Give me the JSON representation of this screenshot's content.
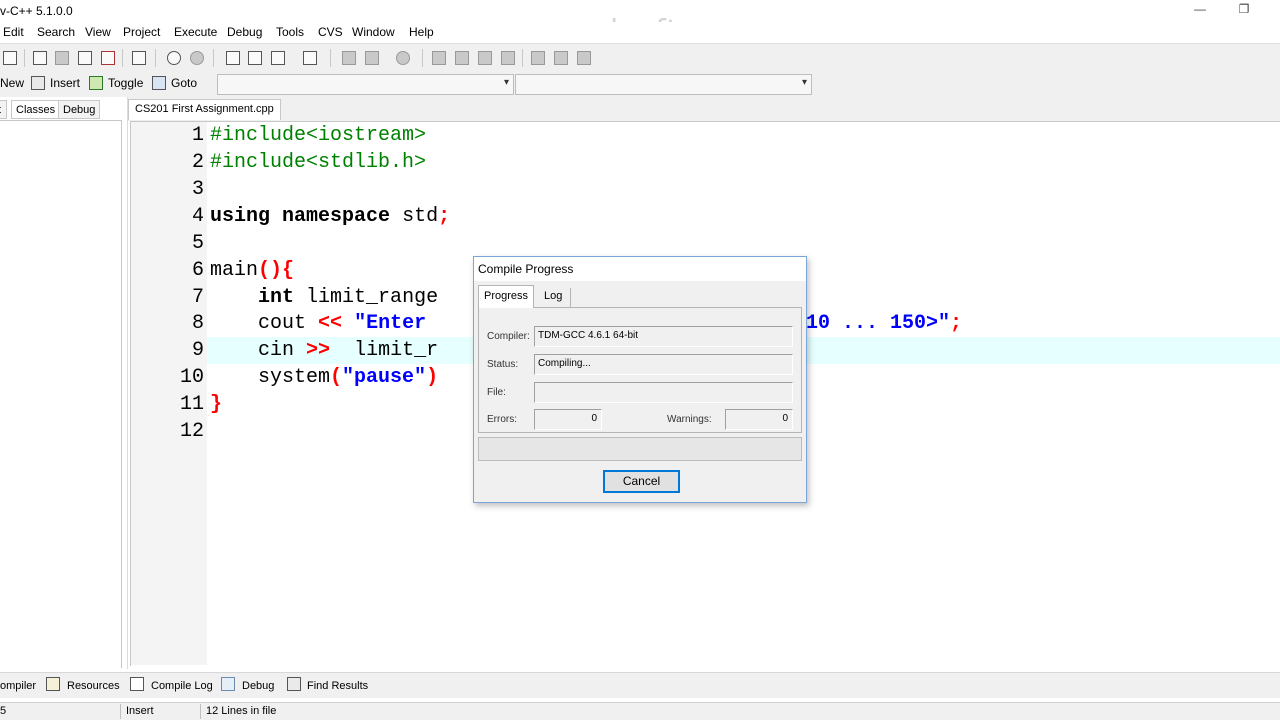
{
  "window": {
    "title": "v-C++ 5.1.0.0",
    "watermark": "www.zdsoft.com",
    "minimize_glyph": "—",
    "restore_glyph": "❐"
  },
  "menu": [
    {
      "label": "Edit"
    },
    {
      "label": "Search"
    },
    {
      "label": "View"
    },
    {
      "label": "Project"
    },
    {
      "label": "Execute"
    },
    {
      "label": "Debug"
    },
    {
      "label": "Tools"
    },
    {
      "label": "CVS"
    },
    {
      "label": "Window"
    },
    {
      "label": "Help"
    }
  ],
  "toolbar2": {
    "new_label": "New",
    "insert_label": "Insert",
    "toggle_label": "Toggle",
    "goto_label": "Goto",
    "combo1_value": "",
    "combo2_value": "",
    "combo_arrow": "▾"
  },
  "left_panel": {
    "tabs": [
      {
        "label": "t"
      },
      {
        "label": "Classes"
      },
      {
        "label": "Debug"
      }
    ]
  },
  "editor": {
    "file_tab": "CS201 First Assignment.cpp",
    "line_numbers": [
      "1",
      "2",
      "3",
      "4",
      "5",
      "6",
      "7",
      "8",
      "9",
      "10",
      "11",
      "12"
    ],
    "highlighted_line": 9,
    "lines": {
      "l1": "#include<iostream>",
      "l2": "#include<stdlib.h>",
      "l4_kw1": "using",
      "l4_kw2": "namespace",
      "l4_rest": "std",
      "l4_semi": ";",
      "l6_name": "main",
      "l6_sym": "(){",
      "l7_kw": "int",
      "l7_rest": "limit_range",
      "l8_cout": "cout",
      "l8_op": "<<",
      "l8_str": "\"Enter",
      "l8_str_tail": "10 ... 150>\"",
      "l8_semi": ";",
      "l9_cin": "cin",
      "l9_op": ">>",
      "l9_rest": "limit_r",
      "l10_name": "system",
      "l10_open": "(",
      "l10_str": "\"pause\"",
      "l10_close": ")",
      "l11": "}"
    }
  },
  "dialog": {
    "title": "Compile Progress",
    "tabs": {
      "progress": "Progress",
      "log": "Log"
    },
    "compiler_label": "Compiler:",
    "compiler_value": "TDM-GCC 4.6.1 64-bit",
    "status_label": "Status:",
    "status_value": "Compiling...",
    "file_label": "File:",
    "file_value": "",
    "errors_label": "Errors:",
    "errors_value": "0",
    "warnings_label": "Warnings:",
    "warnings_value": "0",
    "progress": 0,
    "cancel_label": "Cancel"
  },
  "bottom_tabs": [
    {
      "label": "ompiler"
    },
    {
      "label": "Resources"
    },
    {
      "label": "Compile Log"
    },
    {
      "label": "Debug"
    },
    {
      "label": "Find Results"
    }
  ],
  "status_bar": {
    "line": "5",
    "mode": "Insert",
    "lines_info": "12 Lines in file"
  },
  "colors": {
    "preprocessor": "#008000",
    "symbol": "#ff0000",
    "string": "#0000ff",
    "current_line": "#e6ffff",
    "focus_border": "#0078d7"
  }
}
